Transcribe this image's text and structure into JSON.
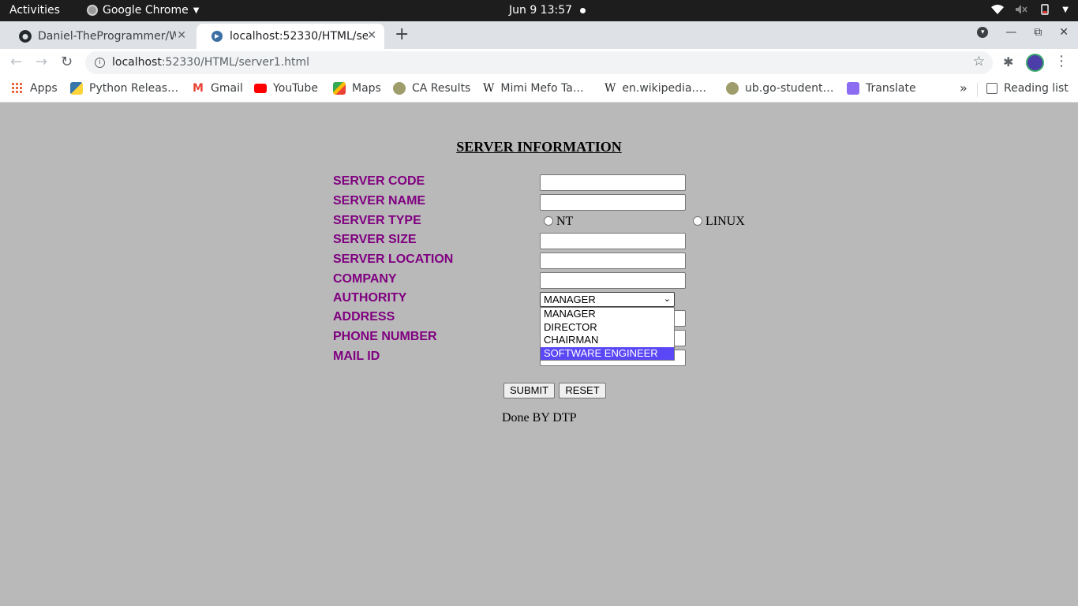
{
  "system_bar": {
    "activities": "Activities",
    "app_name": "Google Chrome",
    "clock": "Jun 9  13:57"
  },
  "tabs": [
    {
      "title": "Daniel-TheProgrammer/W",
      "icon": "github-icon",
      "active": false
    },
    {
      "title": "localhost:52330/HTML/se",
      "icon": "globe-icon",
      "active": true
    }
  ],
  "address_bar": {
    "host": "localhost",
    "path": ":52330/HTML/server1.html"
  },
  "bookmarks": [
    {
      "label": "Apps",
      "icon": "apps-grid-icon"
    },
    {
      "label": "Python Releas…",
      "icon": "python-icon"
    },
    {
      "label": "Gmail",
      "icon": "gmail-icon"
    },
    {
      "label": "YouTube",
      "icon": "youtube-icon"
    },
    {
      "label": "Maps",
      "icon": "maps-icon"
    },
    {
      "label": "CA Results",
      "icon": "ca-results-icon"
    },
    {
      "label": "Mimi Mefo Ta…",
      "icon": "wikipedia-icon"
    },
    {
      "label": "en.wikipedia.…",
      "icon": "wikipedia-icon"
    },
    {
      "label": "ub.go-student…",
      "icon": "ub-icon"
    },
    {
      "label": "Translate",
      "icon": "translate-icon"
    }
  ],
  "reading_list": "Reading list",
  "page": {
    "heading": "SERVER INFORMATION",
    "fields": {
      "server_code": "SERVER CODE",
      "server_name": "SERVER NAME",
      "server_type": "SERVER TYPE",
      "server_size": "SERVER SIZE",
      "server_location": "SERVER LOCATION",
      "company": "COMPANY",
      "authority": "AUTHORITY",
      "address": "ADDRESS",
      "phone_number": "PHONE NUMBER",
      "mail_id": "MAIL ID"
    },
    "server_type_options": [
      "NT",
      "LINUX"
    ],
    "authority": {
      "selected": "MANAGER",
      "options": [
        "MANAGER",
        "DIRECTOR",
        "CHAIRMAN",
        "SOFTWARE ENGINEER"
      ],
      "highlighted": "SOFTWARE ENGINEER"
    },
    "buttons": {
      "submit": "SUBMIT",
      "reset": "RESET"
    },
    "footer": "Done BY DTP"
  },
  "colors": {
    "label_color": "#800080",
    "page_background": "#b9b9b9",
    "highlight": "#5a47f5"
  }
}
